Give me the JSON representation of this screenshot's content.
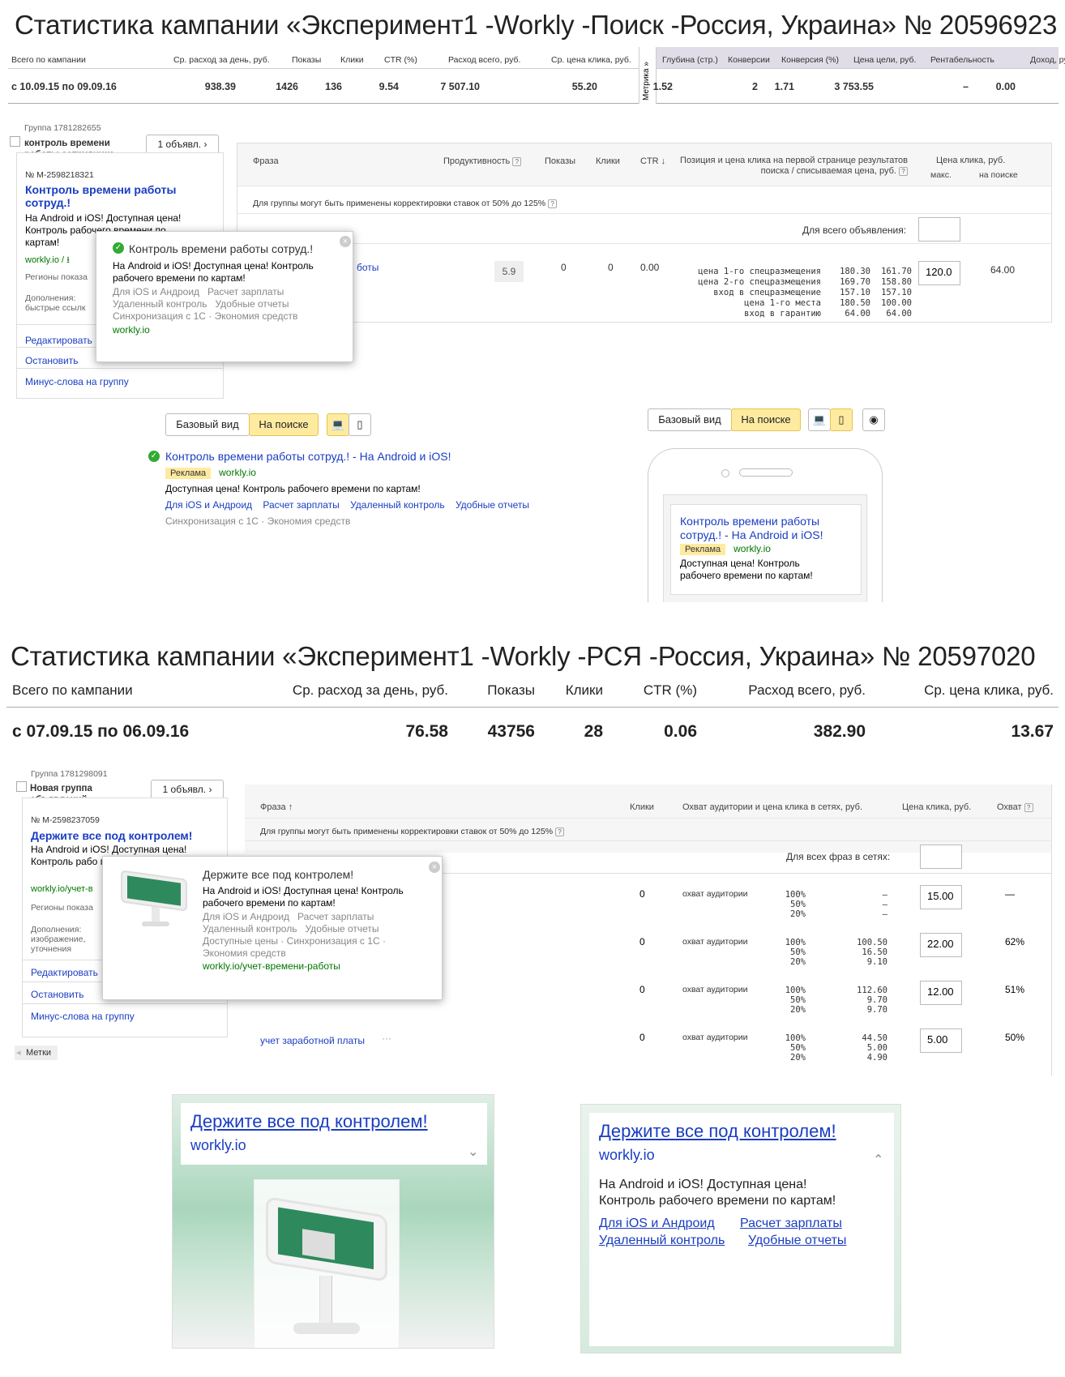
{
  "c1": {
    "title_prefix": "Статистика кампании «Эксперимент1 -Workly -Поиск -Россия, Украина»",
    "title_number": "№ 20596923",
    "headers": [
      "Всего по кампании",
      "Ср. расход за день, руб.",
      "Показы",
      "Клики",
      "CTR (%)",
      "Расход всего, руб.",
      "Ср. цена клика, руб.",
      "Глубина (стр.)",
      "Конверсии",
      "Конверсия (%)",
      "Цена цели, руб.",
      "Рентабельность",
      "Доход, руб."
    ],
    "metrika_label": "Метрика »",
    "values": [
      "с 10.09.15 по 09.09.16",
      "938.39",
      "1426",
      "136",
      "9.54",
      "7 507.10",
      "55.20",
      "1.52",
      "2",
      "1.71",
      "3 753.55",
      "–",
      "0.00"
    ],
    "group_label": "Группа 1781282655",
    "group_name": "контроль времени работы сотрудника",
    "ads_count": "1 объявл. ›",
    "ad_id": "№ M-2598218321",
    "ad_title": "Контроль времени работы сотруд.!",
    "ad_text": "На Android и iOS! Доступная цена! Контроль рабочего времени по картам!",
    "ad_url": "workly.io",
    "ad_url_extra": "/ ⭳",
    "regions": "Регионы показа",
    "extras_label": "Дополнения:",
    "extras_value": "быстрые ссылк",
    "actions": [
      "Редактировать",
      "Остановить",
      "Минус-слова на группу"
    ],
    "table": {
      "col_phrase": "Фраза",
      "col_prod": "Продуктивность",
      "col_shows": "Показы",
      "col_clicks": "Клики",
      "col_ctr": "CTR ↓",
      "col_position": "Позиция и цена клика на первой странице результатов поиска / списываемая цена, руб.",
      "col_price": "Цена клика, руб.",
      "col_max": "макс.",
      "col_onsearch": "на поиске",
      "note": "Для группы могут быть применены корректировки ставок от 50% до 125%",
      "all_ads": "Для всего объявления:",
      "row": {
        "phrase": "боты",
        "prod": "5.9",
        "shows": "0",
        "clicks": "0",
        "ctr": "0.00",
        "bid": "120.0",
        "onsearch": "64.00",
        "positions": [
          "цена 1-го спецразмещения",
          "цена 2-го спецразмещения",
          "вход в спецразмещение",
          "цена 1-го места",
          "вход в гарантию"
        ],
        "pos_a": [
          "180.30",
          "169.70",
          "157.10",
          "180.50",
          "64.00"
        ],
        "pos_b": [
          "161.70",
          "158.80",
          "157.10",
          "100.00",
          "64.00"
        ]
      }
    },
    "popup": {
      "title": "Контроль времени работы сотруд.!",
      "text": "На Android и iOS! Доступная цена! Контроль рабочего времени по картам!",
      "links1": [
        "Для iOS и Андроид",
        "Расчет зарплаты"
      ],
      "links2": [
        "Удаленный контроль",
        "Удобные отчеты"
      ],
      "links3": [
        "Синхронизация с 1С",
        "Экономия средств"
      ],
      "url": "workly.io"
    },
    "preview": {
      "basic": "Базовый вид",
      "onsearch": "На поиске",
      "title": "Контроль времени работы сотруд.! - На Android и iOS!",
      "badge": "Реклама",
      "url": "workly.io",
      "text": "Доступная цена! Контроль рабочего времени по картам!",
      "links": [
        "Для iOS и Андроид",
        "Расчет зарплаты",
        "Удаленный контроль",
        "Удобные отчеты"
      ],
      "links2": [
        "Синхронизация с 1С",
        "Экономия средств"
      ],
      "mobile_title": "Контроль времени работы сотруд.! - На Android и iOS!",
      "mobile_text": "Доступная цена! Контроль рабочего времени по картам!"
    }
  },
  "c2": {
    "title_prefix": "Статистика кампании «Эксперимент1 -Workly -РСЯ -Россия, Украина»",
    "title_number": "№ 20597020",
    "headers": [
      "Всего по кампании",
      "Ср. расход за день, руб.",
      "Показы",
      "Клики",
      "CTR (%)",
      "Расход всего, руб.",
      "Ср. цена клика, руб."
    ],
    "values": [
      "с 07.09.15 по 06.09.16",
      "76.58",
      "43756",
      "28",
      "0.06",
      "382.90",
      "13.67"
    ],
    "group_label": "Группа 1781298091",
    "group_name": "Новая группа объявлений",
    "ads_count": "1 объявл. ›",
    "ad_id": "№ M-2598237059",
    "ad_title": "Держите все под контролем!",
    "ad_text": "На Android и iOS! Доступная цена! Контроль рабо по картам!",
    "ad_url": "workly.io/учет-в",
    "regions": "Регионы показа",
    "extras_label": "Дополнения:",
    "extras_value": "изображение, уточнения",
    "actions": [
      "Редактировать",
      "Остановить",
      "Минус-слова на группу"
    ],
    "tags": "Метки",
    "table": {
      "col_phrase": "Фраза ↑",
      "col_clicks": "Клики",
      "col_reach": "Охват аудитории и цена клика в сетях, руб.",
      "col_price": "Цена клика, руб.",
      "col_cover": "Охват",
      "note": "Для группы могут быть применены корректировки ставок от 50% до 125%",
      "all_phrases": "Для всех фраз в сетях:",
      "rows": [
        {
          "phrase": "",
          "clicks": "0",
          "label": "охват аудитории",
          "pct": [
            "100%",
            "50%",
            "20%"
          ],
          "vals": [
            "—",
            "—",
            "—"
          ],
          "bid": "15.00",
          "cover": "—"
        },
        {
          "phrase": "",
          "clicks": "0",
          "label": "охват аудитории",
          "pct": [
            "100%",
            "50%",
            "20%"
          ],
          "vals": [
            "100.50",
            "16.50",
            "9.10"
          ],
          "bid": "22.00",
          "cover": "62%"
        },
        {
          "phrase": "",
          "clicks": "0",
          "label": "охват аудитории",
          "pct": [
            "100%",
            "50%",
            "20%"
          ],
          "vals": [
            "112.60",
            "9.70",
            "9.70"
          ],
          "bid": "12.00",
          "cover": "51%"
        },
        {
          "phrase": "учет заработной платы",
          "clicks": "0",
          "label": "охват аудитории",
          "pct": [
            "100%",
            "50%",
            "20%"
          ],
          "vals": [
            "44.50",
            "5.00",
            "4.90"
          ],
          "bid": "5.00",
          "cover": "50%"
        }
      ]
    },
    "popup": {
      "title": "Держите все под контролем!",
      "text": "На Android и iOS! Доступная цена! Контроль рабочего времени по картам!",
      "links1": [
        "Для iOS и Андроид",
        "Расчет зарплаты"
      ],
      "links2": [
        "Удаленный контроль",
        "Удобные отчеты"
      ],
      "links3": [
        "Доступные цены",
        "Синхронизация с 1С"
      ],
      "links4": "Экономия средств",
      "url": "workly.io/учет-времени-работы"
    },
    "banner1": {
      "title": "Держите все под контролем!",
      "url": "workly.io"
    },
    "banner2": {
      "title": "Держите все под контролем!",
      "url": "workly.io",
      "text": "На Android и iOS! Доступная цена! Контроль рабочего времени по картам!",
      "links": [
        "Для iOS и Андроид",
        "Расчет зарплаты",
        "Удаленный контроль",
        "Удобные отчеты"
      ]
    }
  },
  "colors": {
    "link": "#1a3dc1",
    "url": "#007700",
    "badge": "#ffeba0",
    "metrika_header": "#e0dde8"
  }
}
